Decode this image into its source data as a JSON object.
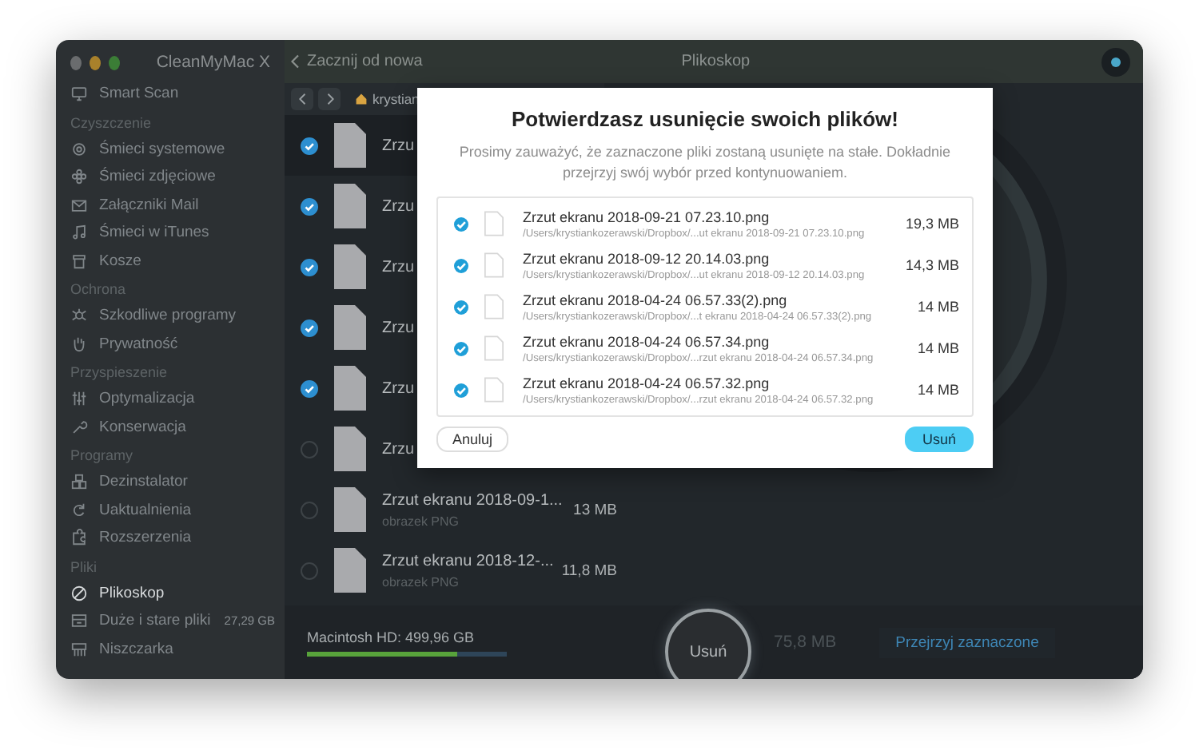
{
  "window": {
    "app_name": "CleanMyMac X",
    "back_label": "Zacznij od nowa",
    "title": "Plikoskop"
  },
  "sidebar": {
    "sections": [
      {
        "items": [
          {
            "label": "Smart Scan",
            "selected": false
          }
        ]
      },
      {
        "heading": "Czyszczenie",
        "items": [
          {
            "label": "Śmieci systemowe",
            "selected": false
          },
          {
            "label": "Śmieci zdjęciowe",
            "selected": false
          },
          {
            "label": "Załączniki Mail",
            "selected": false
          },
          {
            "label": "Śmieci w iTunes",
            "selected": false
          },
          {
            "label": "Kosze",
            "selected": false
          }
        ]
      },
      {
        "heading": "Ochrona",
        "items": [
          {
            "label": "Szkodliwe programy",
            "selected": false
          },
          {
            "label": "Prywatność",
            "selected": false
          }
        ]
      },
      {
        "heading": "Przyspieszenie",
        "items": [
          {
            "label": "Optymalizacja",
            "selected": false
          },
          {
            "label": "Konserwacja",
            "selected": false
          }
        ]
      },
      {
        "heading": "Programy",
        "items": [
          {
            "label": "Dezinstalator",
            "selected": false
          },
          {
            "label": "Uaktualnienia",
            "selected": false
          },
          {
            "label": "Rozszerzenia",
            "selected": false
          }
        ]
      },
      {
        "heading": "Pliki",
        "items": [
          {
            "label": "Plikoskop",
            "selected": true
          },
          {
            "label": "Duże i stare pliki",
            "selected": false,
            "badge": "27,29 GB"
          },
          {
            "label": "Niszczarka",
            "selected": false
          }
        ]
      }
    ]
  },
  "browser": {
    "path": "krystian",
    "rows": [
      {
        "name": "Zrzu",
        "checked": true
      },
      {
        "name": "Zrzu",
        "checked": true
      },
      {
        "name": "Zrzu",
        "checked": true
      },
      {
        "name": "Zrzu",
        "checked": true
      },
      {
        "name": "Zrzu",
        "checked": true
      },
      {
        "name": "Zrzu",
        "checked": false
      },
      {
        "name": "Zrzut ekranu 2018-09-1...",
        "type": "obrazek PNG",
        "size": "13 MB",
        "checked": false
      },
      {
        "name": "Zrzut ekranu 2018-12-...",
        "type": "obrazek PNG",
        "size": "11,8 MB",
        "checked": false
      }
    ]
  },
  "footer": {
    "disk": {
      "label": "Macintosh HD: 499,96 GB",
      "level": 0.75
    },
    "action": "Usuń",
    "total": "75,8 MB",
    "review": "Przejrzyj zaznaczone"
  },
  "dialog": {
    "title": "Potwierdzasz usunięcie swoich plików!",
    "message": "Prosimy zauważyć, że zaznaczone pliki zostaną usunięte na stałe. Dokładnie przejrzyj swój wybór przed kontynuowaniem.",
    "files": [
      {
        "name": "Zrzut ekranu 2018-09-21 07.23.10.png",
        "path": "/Users/krystiankozerawski/Dropbox/...ut ekranu 2018-09-21 07.23.10.png",
        "size": "19,3 MB",
        "checked": true
      },
      {
        "name": "Zrzut ekranu 2018-09-12 20.14.03.png",
        "path": "/Users/krystiankozerawski/Dropbox/...ut ekranu 2018-09-12 20.14.03.png",
        "size": "14,3 MB",
        "checked": true
      },
      {
        "name": "Zrzut ekranu 2018-04-24 06.57.33(2).png",
        "path": "/Users/krystiankozerawski/Dropbox/...t ekranu 2018-04-24 06.57.33(2).png",
        "size": "14 MB",
        "checked": true
      },
      {
        "name": "Zrzut ekranu 2018-04-24 06.57.34.png",
        "path": "/Users/krystiankozerawski/Dropbox/...rzut ekranu 2018-04-24 06.57.34.png",
        "size": "14 MB",
        "checked": true
      },
      {
        "name": "Zrzut ekranu 2018-04-24 06.57.32.png",
        "path": "/Users/krystiankozerawski/Dropbox/...rzut ekranu 2018-04-24 06.57.32.png",
        "size": "14 MB",
        "checked": true
      }
    ],
    "cancel": "Anuluj",
    "confirm": "Usuń"
  }
}
